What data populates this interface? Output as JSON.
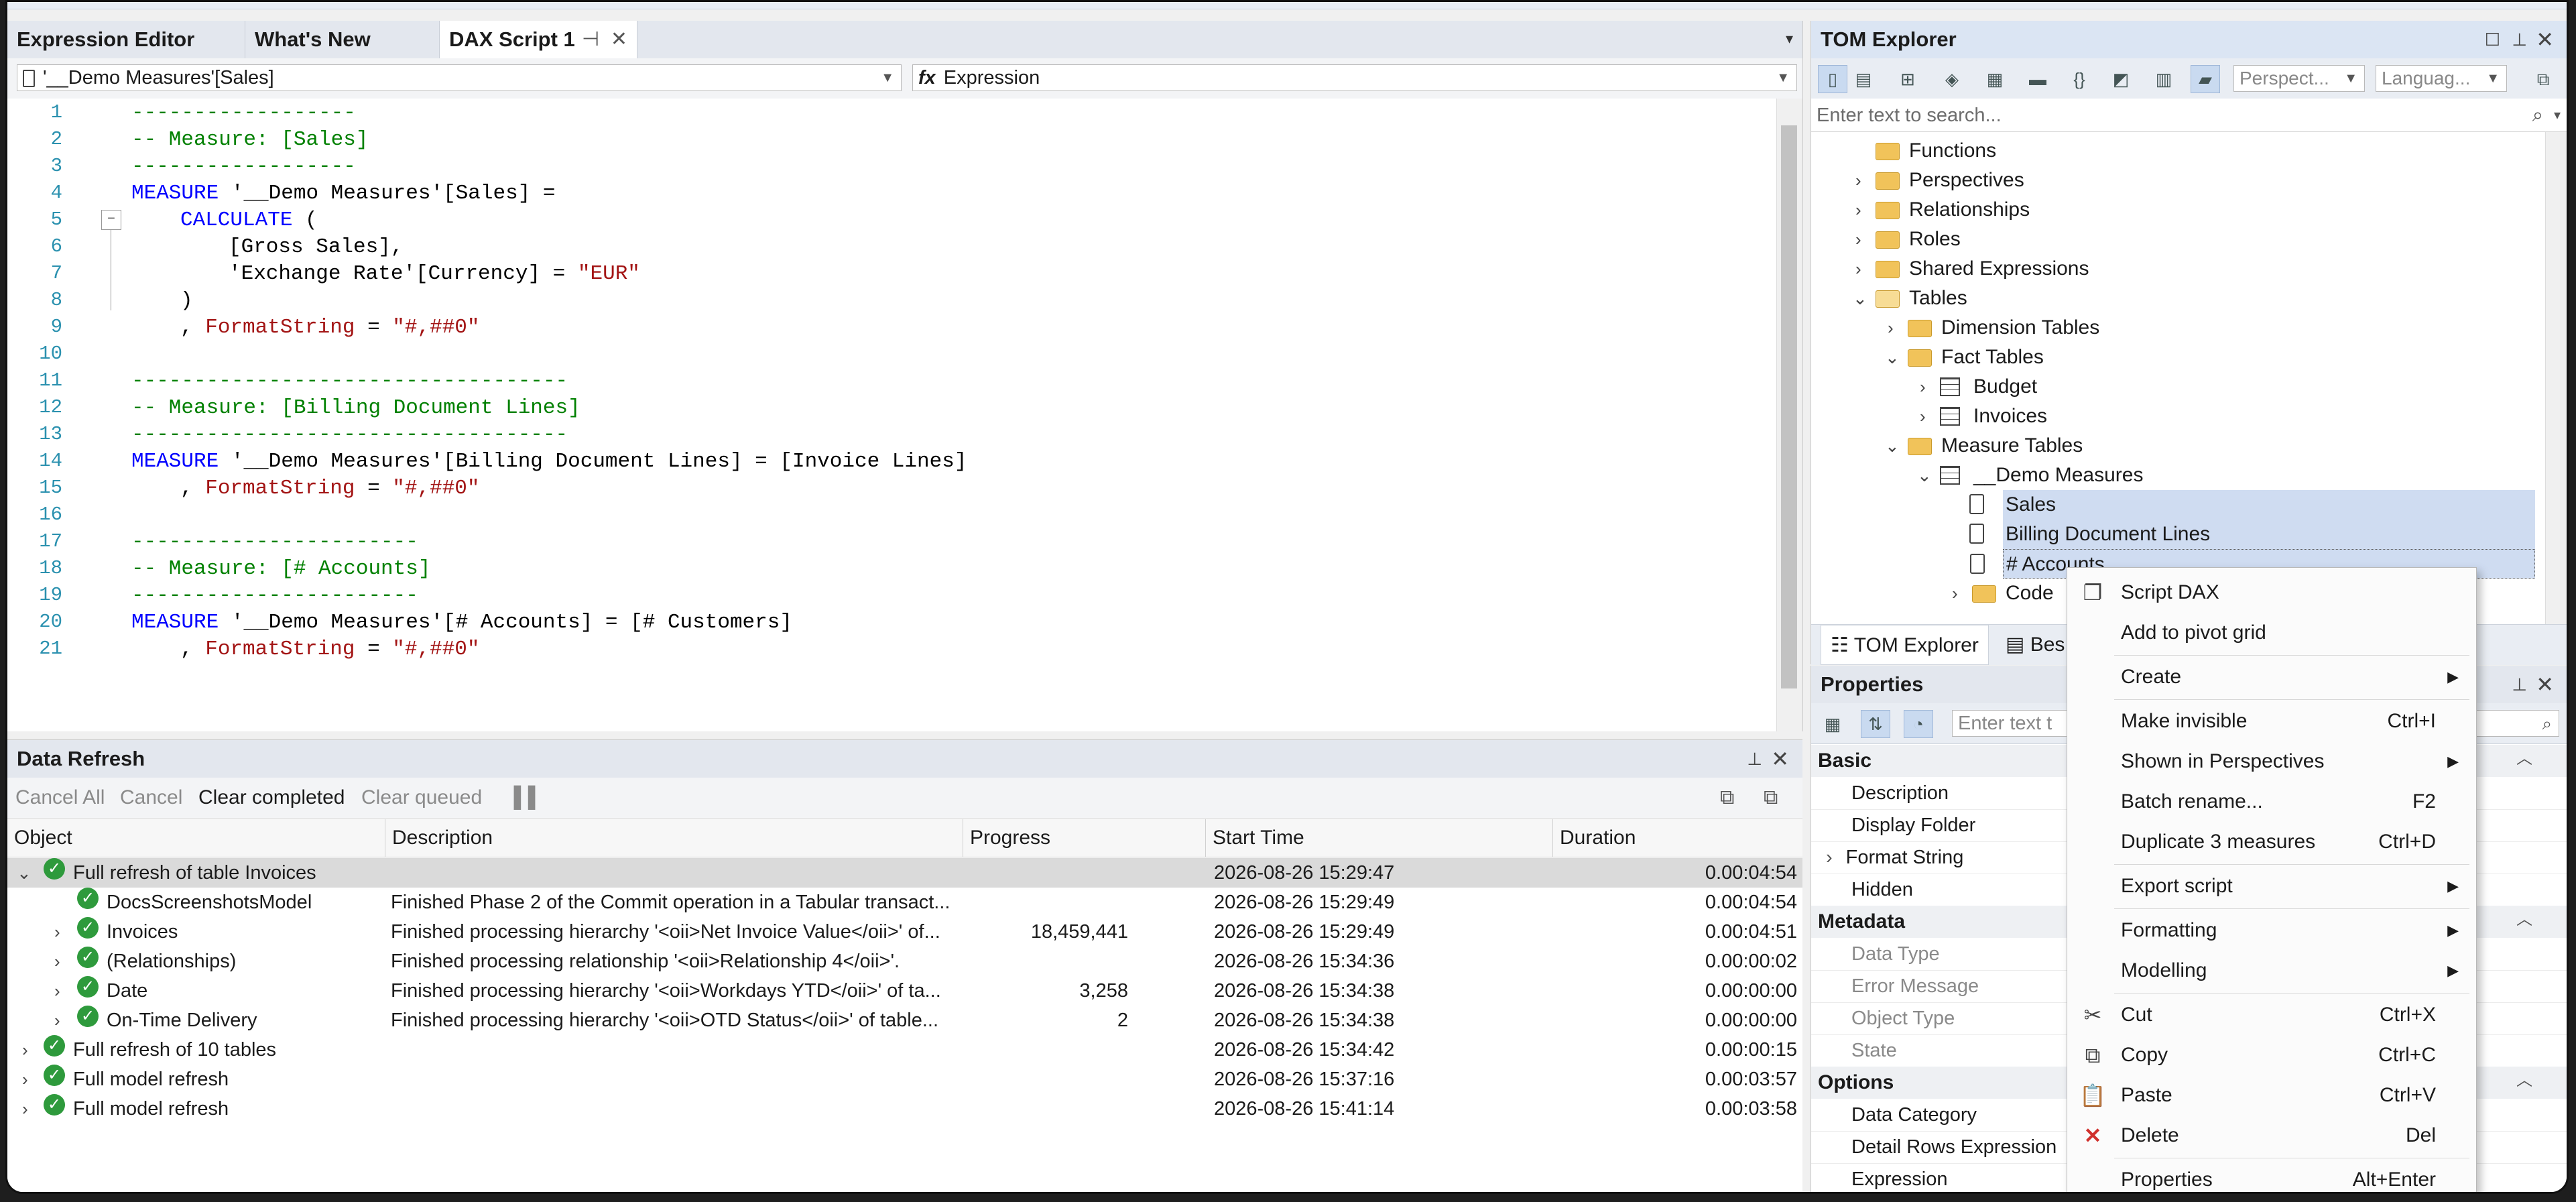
{
  "editor": {
    "tabs": [
      {
        "label": "Expression Editor"
      },
      {
        "label": "What's New"
      },
      {
        "label": "DAX Script 1"
      }
    ],
    "object_selector": "'__Demo Measures'[Sales]",
    "property_selector": "Expression",
    "lines": [
      {
        "n": "1"
      },
      {
        "n": "2"
      },
      {
        "n": "3"
      },
      {
        "n": "4"
      },
      {
        "n": "5"
      },
      {
        "n": "6"
      },
      {
        "n": "7"
      },
      {
        "n": "8"
      },
      {
        "n": "9"
      },
      {
        "n": "10"
      },
      {
        "n": "11"
      },
      {
        "n": "12"
      },
      {
        "n": "13"
      },
      {
        "n": "14"
      },
      {
        "n": "15"
      },
      {
        "n": "16"
      },
      {
        "n": "17"
      },
      {
        "n": "18"
      },
      {
        "n": "19"
      },
      {
        "n": "20"
      },
      {
        "n": "21"
      }
    ],
    "code": {
      "l1": "------------------",
      "l2": "-- Measure: [Sales]",
      "l3": "------------------",
      "l4_kw": "MEASURE",
      "l4_rest": " '__Demo Measures'[Sales] =",
      "l5_fn": "CALCULATE",
      "l5_rest": " (",
      "l6": "[Gross Sales],",
      "l7_a": "'Exchange Rate'[Currency] = ",
      "l7_str": "\"EUR\"",
      "l8": ")",
      "l9_a": ", ",
      "l9_prop": "FormatString",
      "l9_b": " = ",
      "l9_str": "\"#,##0\"",
      "l11": "-----------------------------------",
      "l12": "-- Measure: [Billing Document Lines]",
      "l13": "-----------------------------------",
      "l14_kw": "MEASURE",
      "l14_rest": " '__Demo Measures'[Billing Document Lines] = [Invoice Lines]",
      "l15_a": ", ",
      "l15_prop": "FormatString",
      "l15_b": " = ",
      "l15_str": "\"#,##0\"",
      "l17": "-----------------------",
      "l18": "-- Measure: [# Accounts]",
      "l19": "-----------------------",
      "l20_kw": "MEASURE",
      "l20_rest": " '__Demo Measures'[# Accounts] = [# Customers]",
      "l21_a": ", ",
      "l21_prop": "FormatString",
      "l21_b": " = ",
      "l21_str": "\"#,##0\""
    }
  },
  "refresh": {
    "title": "Data Refresh",
    "toolbar": {
      "cancel_all": "Cancel All",
      "cancel": "Cancel",
      "clear_completed": "Clear completed",
      "clear_queued": "Clear queued"
    },
    "columns": {
      "object": "Object",
      "description": "Description",
      "progress": "Progress",
      "start_time": "Start Time",
      "duration": "Duration"
    },
    "rows": [
      {
        "object": "Full refresh of table Invoices",
        "description": "",
        "progress": "",
        "start": "2026-08-26 15:29:47",
        "duration": "0.00:04:54"
      },
      {
        "object": "DocsScreenshotsModel",
        "description": "Finished Phase 2 of the Commit operation in a Tabular transact...",
        "progress": "",
        "start": "2026-08-26 15:29:49",
        "duration": "0.00:04:54"
      },
      {
        "object": "Invoices",
        "description": "Finished processing hierarchy '<oii>Net Invoice Value</oii>' of...",
        "progress": "18,459,441",
        "start": "2026-08-26 15:29:49",
        "duration": "0.00:04:51"
      },
      {
        "object": "(Relationships)",
        "description": "Finished processing relationship '<oii>Relationship 4</oii>'.",
        "progress": "",
        "start": "2026-08-26 15:34:36",
        "duration": "0.00:00:02"
      },
      {
        "object": "Date",
        "description": "Finished processing hierarchy '<oii>Workdays YTD</oii>' of ta...",
        "progress": "3,258",
        "start": "2026-08-26 15:34:38",
        "duration": "0.00:00:00"
      },
      {
        "object": "On-Time Delivery",
        "description": "Finished processing hierarchy '<oii>OTD Status</oii>' of table...",
        "progress": "2",
        "start": "2026-08-26 15:34:38",
        "duration": "0.00:00:00"
      },
      {
        "object": "Full refresh of 10 tables",
        "description": "",
        "progress": "",
        "start": "2026-08-26 15:34:42",
        "duration": "0.00:00:15"
      },
      {
        "object": "Full model refresh",
        "description": "",
        "progress": "",
        "start": "2026-08-26 15:37:16",
        "duration": "0.00:03:57"
      },
      {
        "object": "Full model refresh",
        "description": "",
        "progress": "",
        "start": "2026-08-26 15:41:14",
        "duration": "0.00:03:58"
      }
    ]
  },
  "tom": {
    "title": "TOM Explorer",
    "perspective_placeholder": "Perspect...",
    "language_placeholder": "Languag...",
    "search_placeholder": "Enter text to search...",
    "nodes": {
      "functions": "Functions",
      "perspectives": "Perspectives",
      "relationships": "Relationships",
      "roles": "Roles",
      "shared_expressions": "Shared Expressions",
      "tables": "Tables",
      "dimension_tables": "Dimension Tables",
      "fact_tables": "Fact Tables",
      "budget": "Budget",
      "invoices": "Invoices",
      "measure_tables": "Measure Tables",
      "demo_measures": "__Demo Measures",
      "sales": "Sales",
      "billing": "Billing Document Lines",
      "accounts": "# Accounts",
      "code": "Code"
    },
    "bottom_tabs": {
      "tom": "TOM Explorer",
      "best": "Bes"
    }
  },
  "properties": {
    "title": "Properties",
    "search_placeholder": "Enter text t",
    "categories": {
      "basic": "Basic",
      "metadata": "Metadata",
      "options": "Options"
    },
    "rows": {
      "description": "Description",
      "display_folder": "Display Folder",
      "format_string": "Format String",
      "hidden": "Hidden",
      "data_type": "Data Type",
      "error_message": "Error Message",
      "object_type": "Object Type",
      "state": "State",
      "data_category": "Data Category",
      "detail_rows": "Detail Rows Expression",
      "expression": "Expression"
    }
  },
  "context_menu": {
    "script_dax": "Script DAX",
    "add_pivot": "Add to pivot grid",
    "create": "Create",
    "make_invisible": "Make invisible",
    "make_invisible_sc": "Ctrl+I",
    "shown_in_persp": "Shown in Perspectives",
    "batch_rename": "Batch rename...",
    "batch_rename_sc": "F2",
    "duplicate": "Duplicate 3 measures",
    "duplicate_sc": "Ctrl+D",
    "export_script": "Export script",
    "formatting": "Formatting",
    "modelling": "Modelling",
    "cut": "Cut",
    "cut_sc": "Ctrl+X",
    "copy": "Copy",
    "copy_sc": "Ctrl+C",
    "paste": "Paste",
    "paste_sc": "Ctrl+V",
    "delete": "Delete",
    "delete_sc": "Del",
    "properties": "Properties",
    "properties_sc": "Alt+Enter"
  },
  "colors": {
    "accent": "#cfdcf1",
    "ok": "#2e9a3c",
    "delete": "#d0312d"
  }
}
